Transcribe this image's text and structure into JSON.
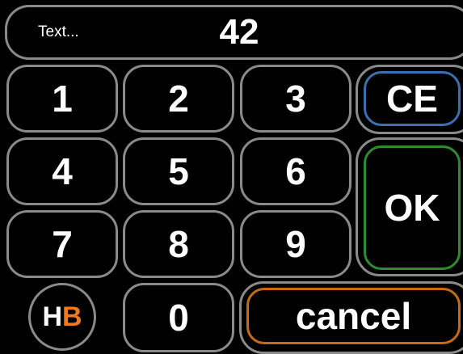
{
  "display": {
    "label": "Text...",
    "value": "42"
  },
  "keypad": {
    "digits": [
      "1",
      "2",
      "3",
      "4",
      "5",
      "6",
      "7",
      "8",
      "9",
      "0"
    ],
    "ce_label": "CE",
    "ok_label": "OK",
    "cancel_label": "cancel"
  },
  "logo": {
    "h": "H",
    "b": "B"
  },
  "colors": {
    "background": "#000000",
    "frame": "#8a8a8a",
    "ce_border": "#3b6fb0",
    "ok_border": "#2e8b2e",
    "cancel_border": "#c86a12",
    "logo_accent": "#f07a1a"
  }
}
